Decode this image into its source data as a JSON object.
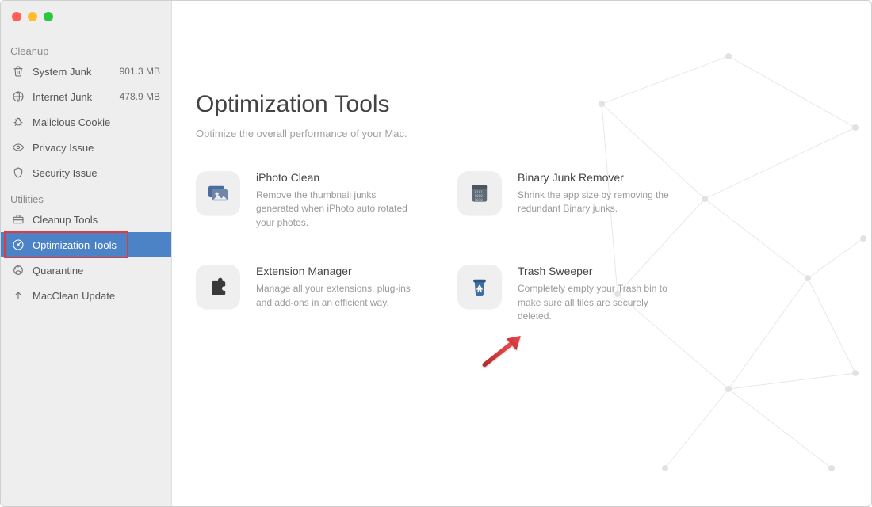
{
  "sidebar": {
    "sections": [
      {
        "label": "Cleanup",
        "items": [
          {
            "label": "System Junk",
            "value": "901.3 MB"
          },
          {
            "label": "Internet Junk",
            "value": "478.9 MB"
          },
          {
            "label": "Malicious Cookie",
            "value": ""
          },
          {
            "label": "Privacy Issue",
            "value": ""
          },
          {
            "label": "Security Issue",
            "value": ""
          }
        ]
      },
      {
        "label": "Utilities",
        "items": [
          {
            "label": "Cleanup Tools",
            "value": ""
          },
          {
            "label": "Optimization Tools",
            "value": "",
            "selected": true,
            "highlighted": true
          },
          {
            "label": "Quarantine",
            "value": ""
          },
          {
            "label": "MacClean Update",
            "value": ""
          }
        ]
      }
    ]
  },
  "main": {
    "title": "Optimization Tools",
    "subtitle": "Optimize the overall performance of your Mac.",
    "tools": [
      {
        "title": "iPhoto Clean",
        "desc": "Remove the thumbnail junks generated when iPhoto auto rotated your photos."
      },
      {
        "title": "Binary Junk Remover",
        "desc": "Shrink the app size by removing the redundant Binary junks."
      },
      {
        "title": "Extension Manager",
        "desc": "Manage all your extensions, plug-ins and add-ons in an efficient way."
      },
      {
        "title": "Trash Sweeper",
        "desc": "Completely empty your Trash bin to make sure all files are securely deleted."
      }
    ]
  }
}
